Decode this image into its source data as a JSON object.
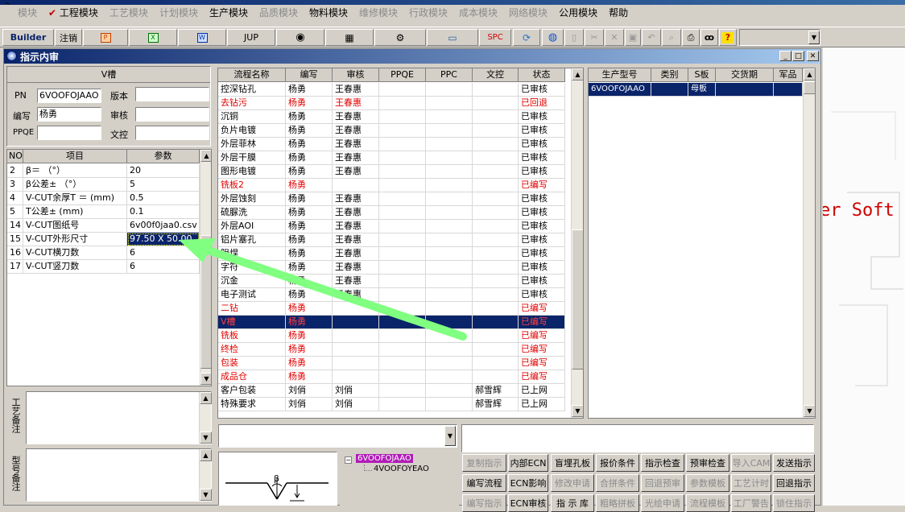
{
  "menu": {
    "items": [
      "模块",
      "工程模块",
      "工艺模块",
      "计划模块",
      "生产模块",
      "品质模块",
      "物料模块",
      "维修模块",
      "行政模块",
      "成本模块",
      "网络模块",
      "公用模块",
      "帮助"
    ]
  },
  "toolbar": {
    "builder": "Builder",
    "logout": "注销",
    "jup": "JUP",
    "spc": "SPC"
  },
  "window": {
    "title": "指示内审"
  },
  "left": {
    "group_title": "V槽",
    "pn_label": "PN",
    "pn_value": "6VOOFOJAAO",
    "version_label": "版本",
    "version_value": "",
    "editor_label": "编写",
    "editor_value": "杨勇",
    "review_label": "审核",
    "review_value": "",
    "ppqe_label": "PPQE",
    "ppqe_value": "",
    "doc_label": "文控",
    "doc_value": "",
    "param_headers": [
      "NO",
      "项目",
      "参数"
    ],
    "params": [
      {
        "no": "2",
        "item": "β＝ （°）",
        "val": "20"
      },
      {
        "no": "3",
        "item": "β公差± （°）",
        "val": "5"
      },
      {
        "no": "4",
        "item": "V-CUT余厚T ＝ (mm)",
        "val": "0.5"
      },
      {
        "no": "5",
        "item": "T公差± (mm)",
        "val": "0.1"
      },
      {
        "no": "14",
        "item": "V-CUT图纸号",
        "val": "6v00f0jaa0.csv"
      },
      {
        "no": "15",
        "item": "V-CUT外形尺寸",
        "val": "97.50 X 50.00"
      },
      {
        "no": "16",
        "item": "V-CUT横刀数",
        "val": "6"
      },
      {
        "no": "17",
        "item": "V-CUT竖刀数",
        "val": "6"
      }
    ],
    "craft_note_label": "工艺备注",
    "model_note_label": "型号备注"
  },
  "flow": {
    "headers": [
      "流程名称",
      "编写",
      "审核",
      "PPQE",
      "PPC",
      "文控",
      "状态"
    ],
    "rows": [
      {
        "name": "控深钻孔",
        "w": "杨勇",
        "r": "王春惠",
        "d": "",
        "s": "已审核",
        "red": false
      },
      {
        "name": "去钻污",
        "w": "杨勇",
        "r": "王春惠",
        "d": "",
        "s": "已回退",
        "red": true
      },
      {
        "name": "沉铜",
        "w": "杨勇",
        "r": "王春惠",
        "d": "",
        "s": "已审核",
        "red": false
      },
      {
        "name": "负片电镀",
        "w": "杨勇",
        "r": "王春惠",
        "d": "",
        "s": "已审核",
        "red": false
      },
      {
        "name": "外层菲林",
        "w": "杨勇",
        "r": "王春惠",
        "d": "",
        "s": "已审核",
        "red": false
      },
      {
        "name": "外层干膜",
        "w": "杨勇",
        "r": "王春惠",
        "d": "",
        "s": "已审核",
        "red": false
      },
      {
        "name": "图形电镀",
        "w": "杨勇",
        "r": "王春惠",
        "d": "",
        "s": "已审核",
        "red": false
      },
      {
        "name": "铣板2",
        "w": "杨勇",
        "r": "",
        "d": "",
        "s": "已编写",
        "red": true
      },
      {
        "name": "外层蚀刻",
        "w": "杨勇",
        "r": "王春惠",
        "d": "",
        "s": "已审核",
        "red": false
      },
      {
        "name": "硫脲洗",
        "w": "杨勇",
        "r": "王春惠",
        "d": "",
        "s": "已审核",
        "red": false
      },
      {
        "name": "外层AOI",
        "w": "杨勇",
        "r": "王春惠",
        "d": "",
        "s": "已审核",
        "red": false
      },
      {
        "name": "铝片塞孔",
        "w": "杨勇",
        "r": "王春惠",
        "d": "",
        "s": "已审核",
        "red": false
      },
      {
        "name": "阻焊",
        "w": "杨勇",
        "r": "王春惠",
        "d": "",
        "s": "已审核",
        "red": false
      },
      {
        "name": "字符",
        "w": "杨勇",
        "r": "王春惠",
        "d": "",
        "s": "已审核",
        "red": false
      },
      {
        "name": "沉金",
        "w": "杨勇",
        "r": "王春惠",
        "d": "",
        "s": "已审核",
        "red": false
      },
      {
        "name": "电子测试",
        "w": "杨勇",
        "r": "王春惠",
        "d": "",
        "s": "已审核",
        "red": false
      },
      {
        "name": "二钻",
        "w": "杨勇",
        "r": "",
        "d": "",
        "s": "已编写",
        "red": true
      },
      {
        "name": "V槽",
        "w": "杨勇",
        "r": "",
        "d": "",
        "s": "已编写",
        "red": true,
        "selected": true
      },
      {
        "name": "铣板",
        "w": "杨勇",
        "r": "",
        "d": "",
        "s": "已编写",
        "red": true
      },
      {
        "name": "终检",
        "w": "杨勇",
        "r": "",
        "d": "",
        "s": "已编写",
        "red": true
      },
      {
        "name": "包装",
        "w": "杨勇",
        "r": "",
        "d": "",
        "s": "已编写",
        "red": true
      },
      {
        "name": "成品仓",
        "w": "杨勇",
        "r": "",
        "d": "",
        "s": "已编写",
        "red": true
      },
      {
        "name": "客户包装",
        "w": "刘俏",
        "r": "刘俏",
        "d": "郝雪辉",
        "s": "已上网",
        "red": false
      },
      {
        "name": "特殊要求",
        "w": "刘俏",
        "r": "刘俏",
        "d": "郝雪辉",
        "s": "已上网",
        "red": false
      }
    ]
  },
  "model": {
    "headers": [
      "生产型号",
      "类别",
      "S板",
      "交货期",
      "军品"
    ],
    "rows": [
      {
        "pn": "6VOOFOJAAO",
        "cat": "",
        "s": "母板",
        "due": "",
        "mil": ""
      }
    ]
  },
  "tree": {
    "root": "6VOOFOJAAO",
    "child": "4VOOFOYEAO"
  },
  "diagram": {
    "beta": "β"
  },
  "buttons": {
    "row1": [
      "复制指示",
      "内部ECN",
      "盲埋孔板",
      "报价条件",
      "指示检查",
      "预审检查",
      "导入CAM",
      "发送指示"
    ],
    "row1_disabled": [
      true,
      false,
      false,
      false,
      false,
      false,
      true,
      false
    ],
    "row2": [
      "编写流程",
      "ECN影响",
      "修改申请",
      "合拼条件",
      "回退预审",
      "参数模板",
      "工艺计时",
      "回退指示"
    ],
    "row2_disabled": [
      false,
      false,
      true,
      true,
      true,
      true,
      true,
      false
    ],
    "row3": [
      "编写指示",
      "ECN审核",
      "指 示 库",
      "粗略拼板",
      "光绘申请",
      "流程模板",
      "工厂警告",
      "锁住指示"
    ],
    "row3_disabled": [
      true,
      false,
      false,
      true,
      true,
      true,
      true,
      true
    ]
  },
  "background": {
    "text": "er Soft"
  },
  "colors": {
    "selection": "#0a246a",
    "red_text": "#e00000",
    "title_start": "#0a246a",
    "title_end": "#a6caf0"
  }
}
